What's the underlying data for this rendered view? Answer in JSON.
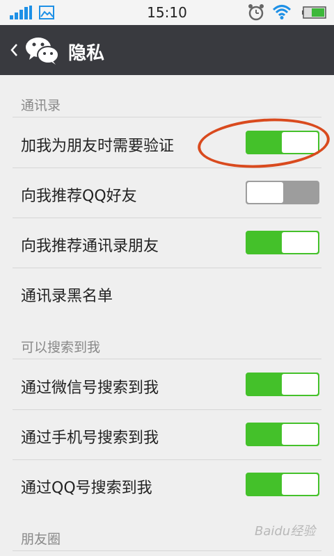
{
  "status_bar": {
    "time": "15:10"
  },
  "header": {
    "title": "隐私"
  },
  "sections": [
    {
      "header": "通讯录",
      "items": [
        {
          "label": "加我为朋友时需要验证",
          "toggle": "on"
        },
        {
          "label": "向我推荐QQ好友",
          "toggle": "off"
        },
        {
          "label": "向我推荐通讯录朋友",
          "toggle": "on"
        },
        {
          "label": "通讯录黑名单"
        }
      ]
    },
    {
      "header": "可以搜索到我",
      "items": [
        {
          "label": "通过微信号搜索到我",
          "toggle": "on"
        },
        {
          "label": "通过手机号搜索到我",
          "toggle": "on"
        },
        {
          "label": "通过QQ号搜索到我",
          "toggle": "on"
        }
      ]
    },
    {
      "header": "朋友圈",
      "items": []
    }
  ],
  "colors": {
    "header_bg": "#393a3f",
    "toggle_on": "#44c12a",
    "toggle_off": "#9d9d9d",
    "annotation": "#d94a1e"
  },
  "watermark": "Baidu经验"
}
